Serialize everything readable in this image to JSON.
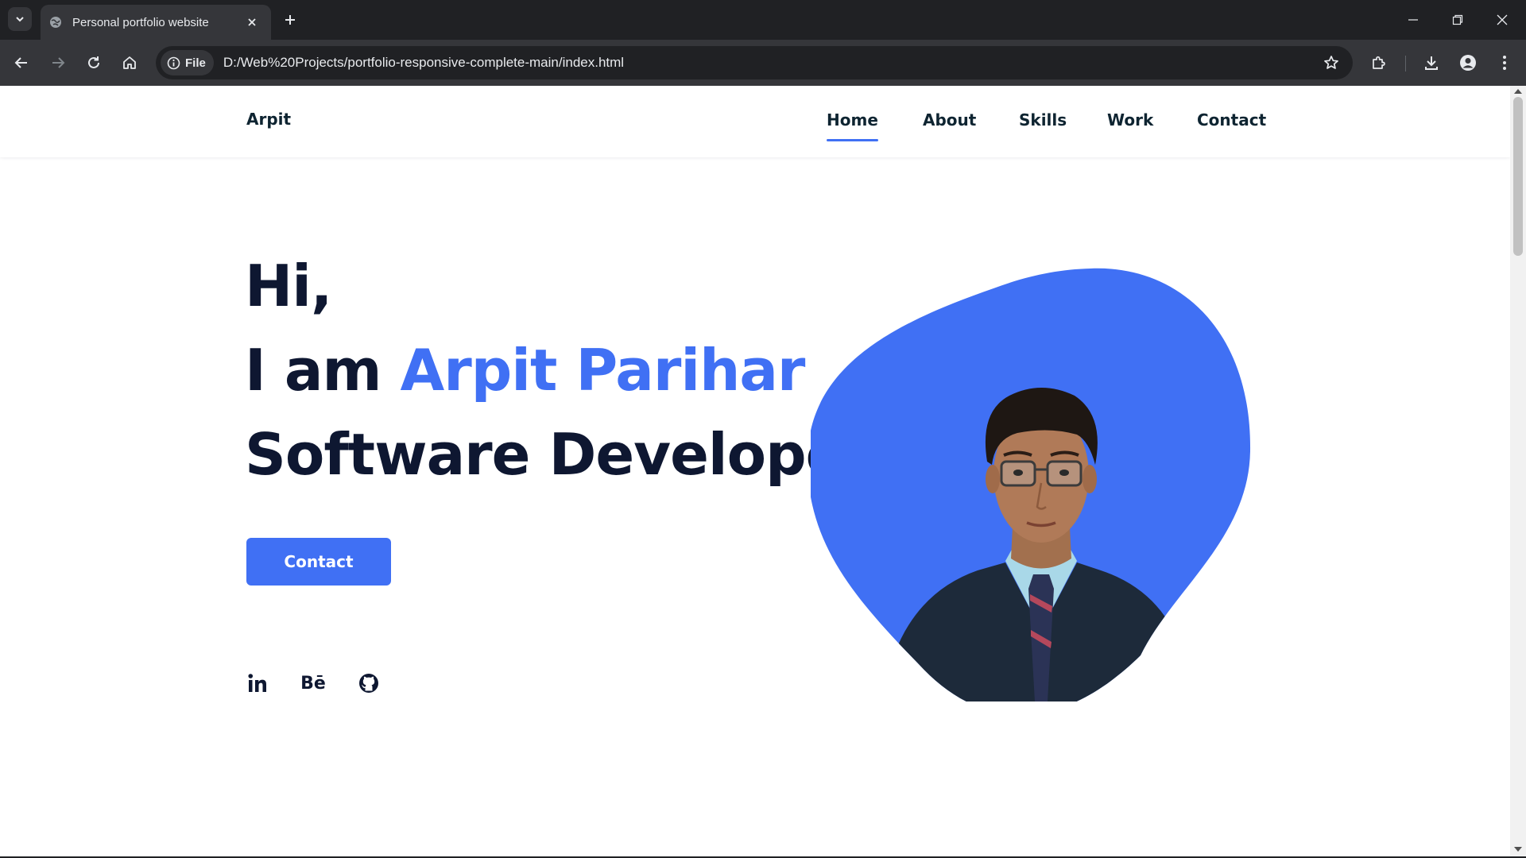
{
  "browser": {
    "tab_title": "Personal portfolio website",
    "site_chip_label": "File",
    "url": "D:/Web%20Projects/portfolio-responsive-complete-main/index.html"
  },
  "site": {
    "logo": "Arpit",
    "nav": [
      {
        "label": "Home",
        "active": true
      },
      {
        "label": "About",
        "active": false
      },
      {
        "label": "Skills",
        "active": false
      },
      {
        "label": "Work",
        "active": false
      },
      {
        "label": "Contact",
        "active": false
      }
    ],
    "hero": {
      "greeting": "Hi,",
      "intro_prefix": "I am ",
      "name": "Arpit Parihar",
      "role": "Software Developer",
      "cta_label": "Contact"
    },
    "social": [
      {
        "icon": "linkedin-icon",
        "label": "in"
      },
      {
        "icon": "behance-icon",
        "label": "Bē"
      },
      {
        "icon": "github-icon",
        "label": ""
      }
    ],
    "photo_alt": "portrait-photo"
  },
  "colors": {
    "accent": "#4070f4",
    "heading": "#0e1731",
    "chrome_dark": "#202124",
    "chrome_mid": "#35363a"
  }
}
